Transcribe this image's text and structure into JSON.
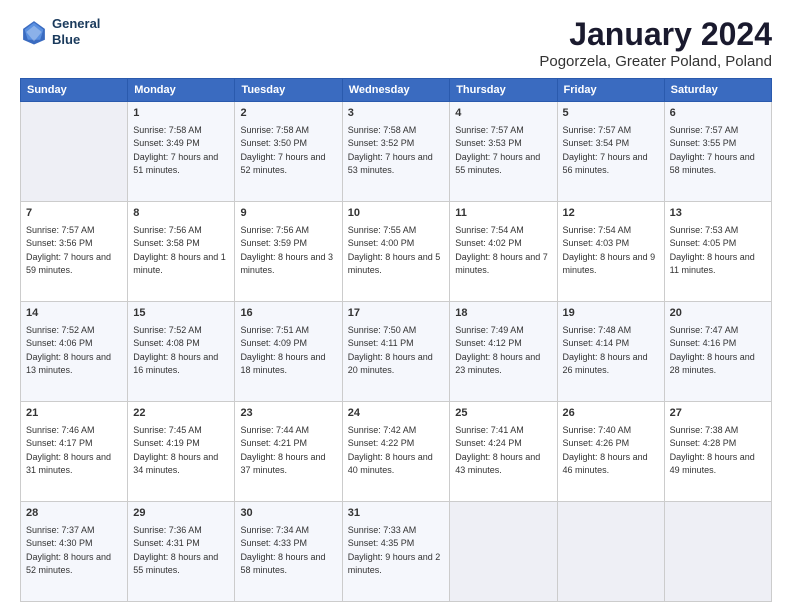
{
  "header": {
    "logo_line1": "General",
    "logo_line2": "Blue",
    "title": "January 2024",
    "subtitle": "Pogorzela, Greater Poland, Poland"
  },
  "weekdays": [
    "Sunday",
    "Monday",
    "Tuesday",
    "Wednesday",
    "Thursday",
    "Friday",
    "Saturday"
  ],
  "weeks": [
    [
      {
        "day": "",
        "sunrise": "",
        "sunset": "",
        "daylight": ""
      },
      {
        "day": "1",
        "sunrise": "Sunrise: 7:58 AM",
        "sunset": "Sunset: 3:49 PM",
        "daylight": "Daylight: 7 hours and 51 minutes."
      },
      {
        "day": "2",
        "sunrise": "Sunrise: 7:58 AM",
        "sunset": "Sunset: 3:50 PM",
        "daylight": "Daylight: 7 hours and 52 minutes."
      },
      {
        "day": "3",
        "sunrise": "Sunrise: 7:58 AM",
        "sunset": "Sunset: 3:52 PM",
        "daylight": "Daylight: 7 hours and 53 minutes."
      },
      {
        "day": "4",
        "sunrise": "Sunrise: 7:57 AM",
        "sunset": "Sunset: 3:53 PM",
        "daylight": "Daylight: 7 hours and 55 minutes."
      },
      {
        "day": "5",
        "sunrise": "Sunrise: 7:57 AM",
        "sunset": "Sunset: 3:54 PM",
        "daylight": "Daylight: 7 hours and 56 minutes."
      },
      {
        "day": "6",
        "sunrise": "Sunrise: 7:57 AM",
        "sunset": "Sunset: 3:55 PM",
        "daylight": "Daylight: 7 hours and 58 minutes."
      }
    ],
    [
      {
        "day": "7",
        "sunrise": "Sunrise: 7:57 AM",
        "sunset": "Sunset: 3:56 PM",
        "daylight": "Daylight: 7 hours and 59 minutes."
      },
      {
        "day": "8",
        "sunrise": "Sunrise: 7:56 AM",
        "sunset": "Sunset: 3:58 PM",
        "daylight": "Daylight: 8 hours and 1 minute."
      },
      {
        "day": "9",
        "sunrise": "Sunrise: 7:56 AM",
        "sunset": "Sunset: 3:59 PM",
        "daylight": "Daylight: 8 hours and 3 minutes."
      },
      {
        "day": "10",
        "sunrise": "Sunrise: 7:55 AM",
        "sunset": "Sunset: 4:00 PM",
        "daylight": "Daylight: 8 hours and 5 minutes."
      },
      {
        "day": "11",
        "sunrise": "Sunrise: 7:54 AM",
        "sunset": "Sunset: 4:02 PM",
        "daylight": "Daylight: 8 hours and 7 minutes."
      },
      {
        "day": "12",
        "sunrise": "Sunrise: 7:54 AM",
        "sunset": "Sunset: 4:03 PM",
        "daylight": "Daylight: 8 hours and 9 minutes."
      },
      {
        "day": "13",
        "sunrise": "Sunrise: 7:53 AM",
        "sunset": "Sunset: 4:05 PM",
        "daylight": "Daylight: 8 hours and 11 minutes."
      }
    ],
    [
      {
        "day": "14",
        "sunrise": "Sunrise: 7:52 AM",
        "sunset": "Sunset: 4:06 PM",
        "daylight": "Daylight: 8 hours and 13 minutes."
      },
      {
        "day": "15",
        "sunrise": "Sunrise: 7:52 AM",
        "sunset": "Sunset: 4:08 PM",
        "daylight": "Daylight: 8 hours and 16 minutes."
      },
      {
        "day": "16",
        "sunrise": "Sunrise: 7:51 AM",
        "sunset": "Sunset: 4:09 PM",
        "daylight": "Daylight: 8 hours and 18 minutes."
      },
      {
        "day": "17",
        "sunrise": "Sunrise: 7:50 AM",
        "sunset": "Sunset: 4:11 PM",
        "daylight": "Daylight: 8 hours and 20 minutes."
      },
      {
        "day": "18",
        "sunrise": "Sunrise: 7:49 AM",
        "sunset": "Sunset: 4:12 PM",
        "daylight": "Daylight: 8 hours and 23 minutes."
      },
      {
        "day": "19",
        "sunrise": "Sunrise: 7:48 AM",
        "sunset": "Sunset: 4:14 PM",
        "daylight": "Daylight: 8 hours and 26 minutes."
      },
      {
        "day": "20",
        "sunrise": "Sunrise: 7:47 AM",
        "sunset": "Sunset: 4:16 PM",
        "daylight": "Daylight: 8 hours and 28 minutes."
      }
    ],
    [
      {
        "day": "21",
        "sunrise": "Sunrise: 7:46 AM",
        "sunset": "Sunset: 4:17 PM",
        "daylight": "Daylight: 8 hours and 31 minutes."
      },
      {
        "day": "22",
        "sunrise": "Sunrise: 7:45 AM",
        "sunset": "Sunset: 4:19 PM",
        "daylight": "Daylight: 8 hours and 34 minutes."
      },
      {
        "day": "23",
        "sunrise": "Sunrise: 7:44 AM",
        "sunset": "Sunset: 4:21 PM",
        "daylight": "Daylight: 8 hours and 37 minutes."
      },
      {
        "day": "24",
        "sunrise": "Sunrise: 7:42 AM",
        "sunset": "Sunset: 4:22 PM",
        "daylight": "Daylight: 8 hours and 40 minutes."
      },
      {
        "day": "25",
        "sunrise": "Sunrise: 7:41 AM",
        "sunset": "Sunset: 4:24 PM",
        "daylight": "Daylight: 8 hours and 43 minutes."
      },
      {
        "day": "26",
        "sunrise": "Sunrise: 7:40 AM",
        "sunset": "Sunset: 4:26 PM",
        "daylight": "Daylight: 8 hours and 46 minutes."
      },
      {
        "day": "27",
        "sunrise": "Sunrise: 7:38 AM",
        "sunset": "Sunset: 4:28 PM",
        "daylight": "Daylight: 8 hours and 49 minutes."
      }
    ],
    [
      {
        "day": "28",
        "sunrise": "Sunrise: 7:37 AM",
        "sunset": "Sunset: 4:30 PM",
        "daylight": "Daylight: 8 hours and 52 minutes."
      },
      {
        "day": "29",
        "sunrise": "Sunrise: 7:36 AM",
        "sunset": "Sunset: 4:31 PM",
        "daylight": "Daylight: 8 hours and 55 minutes."
      },
      {
        "day": "30",
        "sunrise": "Sunrise: 7:34 AM",
        "sunset": "Sunset: 4:33 PM",
        "daylight": "Daylight: 8 hours and 58 minutes."
      },
      {
        "day": "31",
        "sunrise": "Sunrise: 7:33 AM",
        "sunset": "Sunset: 4:35 PM",
        "daylight": "Daylight: 9 hours and 2 minutes."
      },
      {
        "day": "",
        "sunrise": "",
        "sunset": "",
        "daylight": ""
      },
      {
        "day": "",
        "sunrise": "",
        "sunset": "",
        "daylight": ""
      },
      {
        "day": "",
        "sunrise": "",
        "sunset": "",
        "daylight": ""
      }
    ]
  ]
}
